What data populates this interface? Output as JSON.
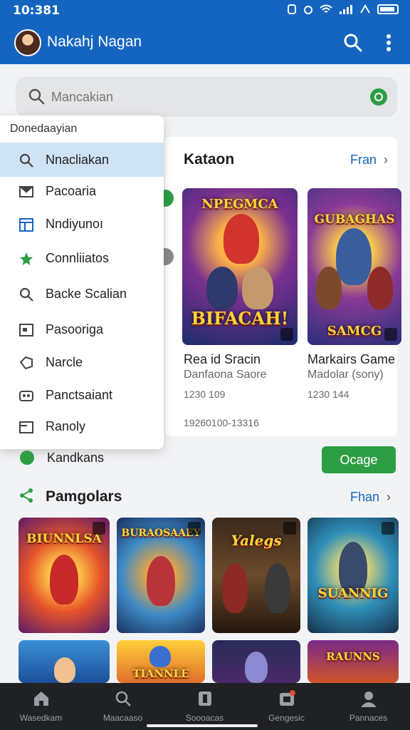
{
  "status_bar": {
    "time": "10:381"
  },
  "app_bar": {
    "title": "Nakahj Nagan"
  },
  "search": {
    "placeholder": "Mancakian"
  },
  "dropdown": {
    "title": "Donedaayian",
    "items": [
      {
        "label": "Nnacliakan",
        "icon": "search-icon"
      },
      {
        "label": "Pacoaria",
        "icon": "mail-icon"
      },
      {
        "label": "Nndiyunoı",
        "icon": "calendar-icon"
      },
      {
        "label": "Connliiatos",
        "icon": "star-icon"
      },
      {
        "label": "Backe Scalian",
        "icon": "search-icon"
      },
      {
        "label": "Pasooriga",
        "icon": "square-icon"
      },
      {
        "label": "Narcle",
        "icon": "tag-icon"
      },
      {
        "label": "Panctsaiant",
        "icon": "gamepad-icon"
      },
      {
        "label": "Ranoly",
        "icon": "folder-icon"
      }
    ]
  },
  "featured": {
    "title": "Kataon",
    "more_label": "Fran",
    "games": [
      {
        "poster_top": "NPEGMCA",
        "poster_bottom": "BIFACAH!",
        "name": "Rea id Sracin",
        "subtitle": "Danfaona Saore",
        "count": "1230 109"
      },
      {
        "poster_top": "GUBAGHAS",
        "poster_bottom": "SAMCG",
        "name": "Markairs Game",
        "subtitle": "Madolar (sony)",
        "count": "1230 144"
      }
    ],
    "date_range": "19260100-13316"
  },
  "kandkans": {
    "label": "Kandkans",
    "button_label": "Ocage"
  },
  "popular": {
    "title": "Pamgolars",
    "more_label": "Fhan",
    "posters": [
      {
        "title": "BIUNNLSA"
      },
      {
        "title": "BURAOSAAEY"
      },
      {
        "title": "Yalegs"
      },
      {
        "title": "SUANNIG"
      },
      {
        "title": ""
      },
      {
        "title": "TIANNLE"
      },
      {
        "title": ""
      },
      {
        "title": "RAUNNS"
      }
    ]
  },
  "bottom_nav": [
    {
      "label": "Wasedkam",
      "icon": "home-icon"
    },
    {
      "label": "Maacaaso",
      "icon": "search-icon"
    },
    {
      "label": "Soooacas",
      "icon": "tablet-icon"
    },
    {
      "label": "Gengesic",
      "icon": "inbox-icon"
    },
    {
      "label": "Pannaces",
      "icon": "profile-icon"
    }
  ],
  "colors": {
    "primary": "#1565c0",
    "accent_green": "#2e9e45",
    "nav_bg": "#202124"
  }
}
